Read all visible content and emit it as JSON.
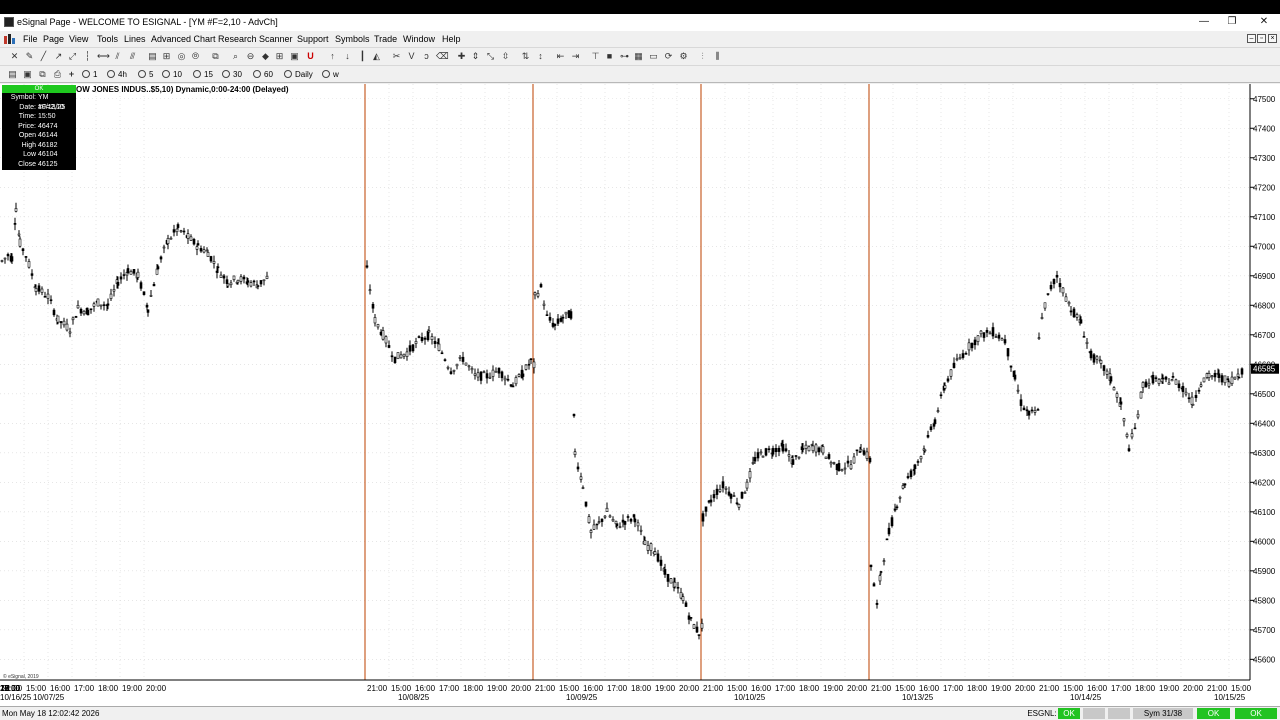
{
  "window": {
    "title": "eSignal Page - WELCOME TO ESIGNAL - [YM #F=2,10 - AdvCh]",
    "minimize": "—",
    "restore": "❐",
    "close": "✕"
  },
  "menu": {
    "items": [
      "File",
      "Page",
      "View",
      "Tools",
      "Lines",
      "Advanced Chart",
      "Research",
      "Scanner",
      "Support",
      "Symbols",
      "Trade",
      "Window",
      "Help"
    ]
  },
  "intervals": {
    "items": [
      "1",
      "4h",
      "5",
      "10",
      "15",
      "30",
      "60",
      "Daily",
      "w"
    ]
  },
  "chart": {
    "title": "OW JONES INDUS..$5,10) Dynamic,0:00-24:00 (Delayed)",
    "copyright": "© eSignal, 2019",
    "cursor": {
      "head": "OK",
      "rows": [
        {
          "label": "Symbol:",
          "value": "YM #F=2,10"
        },
        {
          "label": "Date:",
          "value": "10/13/25"
        },
        {
          "label": "Time:",
          "value": "15:50"
        },
        {
          "label": "Price:",
          "value": "46474"
        },
        {
          "label": "Open",
          "value": "46144"
        },
        {
          "label": "High",
          "value": "46182"
        },
        {
          "label": "Low",
          "value": "46104"
        },
        {
          "label": "Close",
          "value": "46125"
        }
      ]
    },
    "current_price_label": "46585",
    "colors": {
      "candle": "#000000",
      "session_divider": "#c8602a",
      "grid": "#d8d8d8",
      "price_marker": "#000000"
    }
  },
  "chart_data": {
    "type": "candlestick",
    "symbol": "YM #F=2,10",
    "interval": "10 min",
    "ylim": [
      45530,
      47550
    ],
    "y_ticks": [
      45600,
      45700,
      45800,
      45900,
      46000,
      46100,
      46200,
      46300,
      46400,
      46500,
      46600,
      46700,
      46800,
      46900,
      47000,
      47100,
      47200,
      47300,
      47400,
      47500
    ],
    "x_time_labels": [
      "21:00",
      "15:00",
      "16:00",
      "17:00",
      "18:00",
      "19:00",
      "20:00"
    ],
    "sessions": [
      {
        "date": "10/07/25",
        "path": [
          [
            0,
            46950
          ],
          [
            6,
            46970
          ],
          [
            10,
            46960
          ],
          [
            14,
            47130
          ],
          [
            18,
            47010
          ],
          [
            24,
            46970
          ],
          [
            34,
            46860
          ],
          [
            46,
            46830
          ],
          [
            56,
            46750
          ],
          [
            68,
            46720
          ],
          [
            76,
            46790
          ],
          [
            86,
            46780
          ],
          [
            96,
            46810
          ],
          [
            106,
            46800
          ],
          [
            116,
            46880
          ],
          [
            126,
            46920
          ],
          [
            136,
            46900
          ],
          [
            146,
            46790
          ],
          [
            156,
            46930
          ],
          [
            166,
            47020
          ],
          [
            176,
            47060
          ],
          [
            186,
            47030
          ],
          [
            196,
            47000
          ],
          [
            206,
            46980
          ],
          [
            216,
            46920
          ],
          [
            226,
            46880
          ],
          [
            236,
            46890
          ],
          [
            246,
            46880
          ],
          [
            256,
            46870
          ],
          [
            268,
            46900
          ]
        ]
      },
      {
        "date": "10/08/25",
        "path": [
          [
            0,
            46920
          ],
          [
            8,
            46750
          ],
          [
            16,
            46700
          ],
          [
            28,
            46620
          ],
          [
            40,
            46640
          ],
          [
            52,
            46680
          ],
          [
            62,
            46700
          ],
          [
            72,
            46660
          ],
          [
            84,
            46580
          ],
          [
            96,
            46620
          ],
          [
            108,
            46560
          ],
          [
            120,
            46560
          ],
          [
            132,
            46580
          ],
          [
            146,
            46530
          ],
          [
            156,
            46570
          ],
          [
            164,
            46610
          ],
          [
            168,
            46590
          ]
        ]
      },
      {
        "date": "10/09/25",
        "path": [
          [
            0,
            46830
          ],
          [
            6,
            46860
          ],
          [
            12,
            46760
          ],
          [
            20,
            46730
          ],
          [
            28,
            46760
          ],
          [
            36,
            46770
          ],
          [
            40,
            46300
          ],
          [
            48,
            46190
          ],
          [
            56,
            46030
          ],
          [
            64,
            46060
          ],
          [
            72,
            46100
          ],
          [
            82,
            46050
          ],
          [
            90,
            46070
          ],
          [
            100,
            46080
          ],
          [
            110,
            45990
          ],
          [
            120,
            45970
          ],
          [
            130,
            45890
          ],
          [
            140,
            45850
          ],
          [
            148,
            45810
          ],
          [
            156,
            45730
          ],
          [
            164,
            45690
          ],
          [
            168,
            45720
          ]
        ]
      },
      {
        "date": "10/10/25",
        "path": [
          [
            0,
            46080
          ],
          [
            8,
            46140
          ],
          [
            14,
            46170
          ],
          [
            20,
            46190
          ],
          [
            28,
            46160
          ],
          [
            36,
            46130
          ],
          [
            44,
            46190
          ],
          [
            52,
            46280
          ],
          [
            60,
            46300
          ],
          [
            70,
            46310
          ],
          [
            80,
            46320
          ],
          [
            90,
            46270
          ],
          [
            100,
            46310
          ],
          [
            110,
            46320
          ],
          [
            120,
            46310
          ],
          [
            128,
            46270
          ],
          [
            136,
            46250
          ],
          [
            148,
            46260
          ],
          [
            158,
            46320
          ],
          [
            168,
            46270
          ]
        ]
      },
      {
        "date": "10/13/25",
        "path": [
          [
            0,
            45920
          ],
          [
            6,
            45780
          ],
          [
            10,
            45900
          ],
          [
            18,
            46030
          ],
          [
            26,
            46130
          ],
          [
            34,
            46200
          ],
          [
            44,
            46250
          ],
          [
            54,
            46320
          ],
          [
            64,
            46410
          ],
          [
            74,
            46530
          ],
          [
            86,
            46610
          ],
          [
            98,
            46660
          ],
          [
            110,
            46700
          ],
          [
            122,
            46710
          ],
          [
            134,
            46680
          ],
          [
            144,
            46550
          ],
          [
            150,
            46470
          ],
          [
            158,
            46430
          ],
          [
            168,
            46440
          ]
        ]
      },
      {
        "date": "10/14/25",
        "path": [
          [
            0,
            46700
          ],
          [
            6,
            46800
          ],
          [
            12,
            46860
          ],
          [
            18,
            46900
          ],
          [
            24,
            46850
          ],
          [
            32,
            46790
          ],
          [
            42,
            46740
          ],
          [
            52,
            46630
          ],
          [
            62,
            46600
          ],
          [
            72,
            46550
          ],
          [
            82,
            46460
          ],
          [
            90,
            46320
          ],
          [
            96,
            46380
          ],
          [
            104,
            46530
          ],
          [
            114,
            46550
          ],
          [
            124,
            46540
          ],
          [
            134,
            46550
          ],
          [
            144,
            46520
          ],
          [
            154,
            46470
          ],
          [
            162,
            46540
          ],
          [
            170,
            46560
          ],
          [
            180,
            46560
          ],
          [
            190,
            46540
          ],
          [
            200,
            46570
          ],
          [
            206,
            46585
          ]
        ]
      },
      {
        "date": "10/15/25"
      },
      {
        "date": "10/16/25"
      }
    ]
  },
  "status": {
    "datetime": "Mon May 18 12:02:42 2026",
    "esgnl_label": "ESGNL:",
    "ok1": "OK",
    "sym": "Sym 31/38",
    "ok2": "OK",
    "ok3": "OK"
  }
}
